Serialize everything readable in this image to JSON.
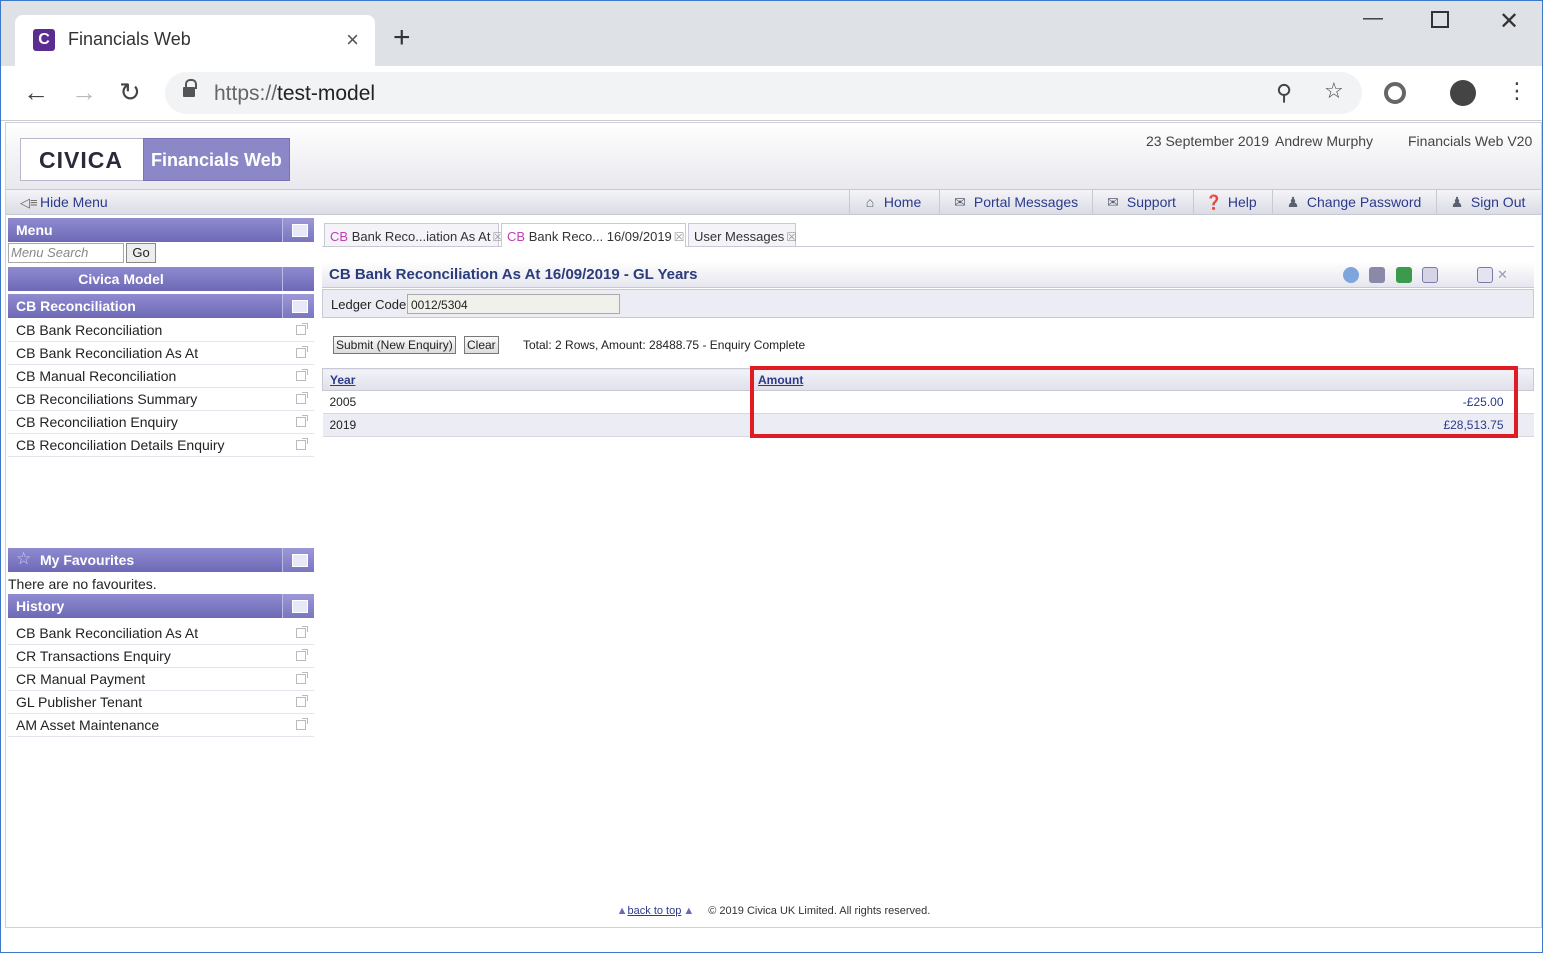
{
  "browser": {
    "tab_title": "Financials Web",
    "favicon_letter": "C",
    "close_glyph": "×",
    "newtab_glyph": "+",
    "url_scheme": "https://",
    "url_host": "test-model"
  },
  "header": {
    "logo": "CIVICA",
    "product": "Financials Web",
    "date": "23 September 2019",
    "user": "Andrew Murphy",
    "version": "Financials Web V20"
  },
  "menubar": {
    "hide_menu": "Hide Menu",
    "nav": [
      {
        "label": "Home",
        "icon": "home-icon"
      },
      {
        "label": "Portal Messages",
        "icon": "messages-icon"
      },
      {
        "label": "Support",
        "icon": "mail-icon"
      },
      {
        "label": "Help",
        "icon": "help-icon"
      },
      {
        "label": "Change Password",
        "icon": "user-key-icon"
      },
      {
        "label": "Sign Out",
        "icon": "sign-out-icon"
      }
    ]
  },
  "sidebar": {
    "menu_title": "Menu",
    "search_placeholder": "Menu Search",
    "go_label": "Go",
    "model_title": "Civica Model",
    "section_title": "CB Reconciliation",
    "items": [
      "CB Bank Reconciliation",
      "CB Bank Reconciliation As At",
      "CB Manual Reconciliation",
      "CB Reconciliations Summary",
      "CB Reconciliation Enquiry",
      "CB Reconciliation Details Enquiry"
    ],
    "favourites_title": "My Favourites",
    "favourites_empty": "There are no favourites.",
    "history_title": "History",
    "history": [
      "CB Bank Reconciliation As At",
      "CR Transactions Enquiry",
      "CR Manual Payment",
      "GL Publisher Tenant",
      "AM Asset Maintenance"
    ]
  },
  "tabs": [
    {
      "prefix": "CB",
      "label": "Bank Reco...iation As At"
    },
    {
      "prefix": "CB",
      "label": "Bank Reco... 16/09/2019"
    },
    {
      "prefix": "",
      "label": "User Messages"
    }
  ],
  "page": {
    "title": "CB Bank Reconciliation As At 16/09/2019 - GL Years",
    "ledger_label": "Ledger Code",
    "ledger_value": "0012/5304",
    "submit_label": "Submit (New Enquiry)",
    "clear_label": "Clear",
    "total_text": "Total: 2 Rows, Amount: 28488.75 - Enquiry Complete",
    "columns": [
      "Year",
      "Amount"
    ],
    "rows": [
      {
        "year": "2005",
        "amount": "-£25.00"
      },
      {
        "year": "2019",
        "amount": "£28,513.75"
      }
    ]
  },
  "footer": {
    "back_to_top": "back to top",
    "copyright": "© 2019 Civica UK Limited. All rights reserved."
  },
  "colors": {
    "accent": "#7a76c0",
    "link": "#2b3a8a",
    "highlight": "#e01b24"
  }
}
